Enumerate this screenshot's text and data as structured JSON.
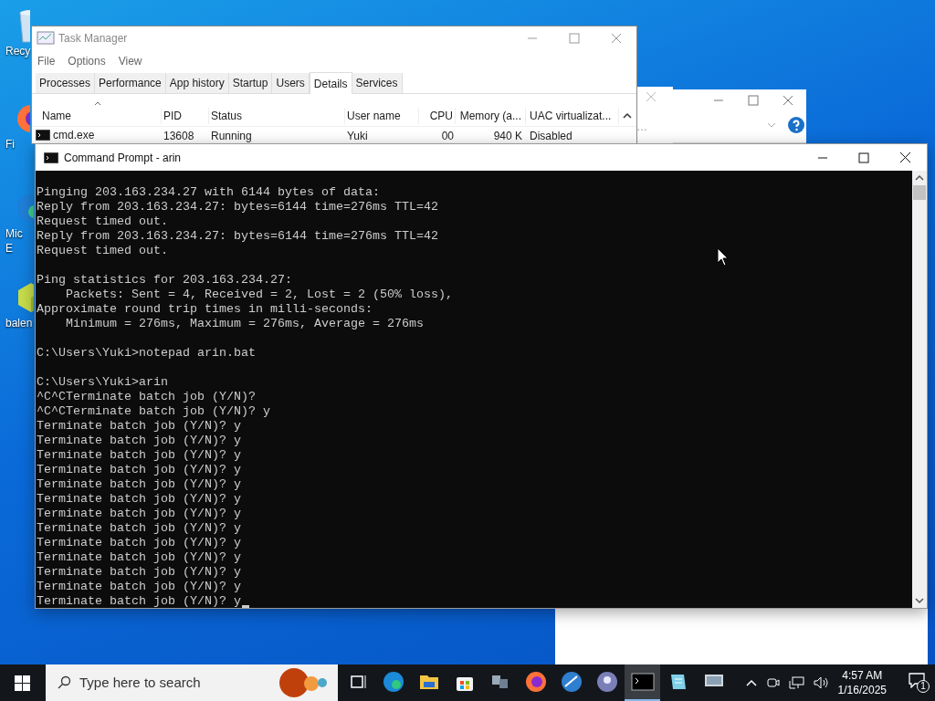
{
  "desktop_icons": [
    {
      "kind": "recycle",
      "label_lines": [
        "Recy"
      ]
    },
    {
      "kind": "firefox",
      "label_lines": [
        "Fi"
      ]
    },
    {
      "kind": "edge",
      "label_lines": [
        "Mic",
        "E"
      ]
    },
    {
      "kind": "balena",
      "label_lines": [
        "balen"
      ]
    }
  ],
  "background_window": {
    "ellipsis": "…"
  },
  "task_manager": {
    "title": "Task Manager",
    "menu": [
      "File",
      "Options",
      "View"
    ],
    "tabs": [
      {
        "label": "Processes",
        "selected": false
      },
      {
        "label": "Performance",
        "selected": false
      },
      {
        "label": "App history",
        "selected": false
      },
      {
        "label": "Startup",
        "selected": false
      },
      {
        "label": "Users",
        "selected": false
      },
      {
        "label": "Details",
        "selected": true
      },
      {
        "label": "Services",
        "selected": false
      }
    ],
    "columns": [
      "Name",
      "PID",
      "Status",
      "User name",
      "CPU",
      "Memory (a...",
      "UAC virtualizat..."
    ],
    "rows": [
      [
        "cmd.exe",
        "13608",
        "Running",
        "Yuki",
        "00",
        "940 K",
        "Disabled"
      ]
    ]
  },
  "command_prompt": {
    "title": "Command Prompt - arin",
    "blocks": [
      [
        "Pinging 203.163.234.27 with 6144 bytes of data:",
        "Reply from 203.163.234.27: bytes=6144 time=276ms TTL=42",
        "Request timed out.",
        "Reply from 203.163.234.27: bytes=6144 time=276ms TTL=42",
        "Request timed out."
      ],
      [
        "Ping statistics for 203.163.234.27:",
        "    Packets: Sent = 4, Received = 2, Lost = 2 (50% loss),",
        "Approximate round trip times in milli-seconds:",
        "    Minimum = 276ms, Maximum = 276ms, Average = 276ms"
      ],
      [
        "C:\\Users\\Yuki>notepad arin.bat"
      ],
      [
        "C:\\Users\\Yuki>arin",
        "^C^CTerminate batch job (Y/N)?",
        "^C^CTerminate batch job (Y/N)? y",
        "Terminate batch job (Y/N)? y",
        "Terminate batch job (Y/N)? y",
        "Terminate batch job (Y/N)? y",
        "Terminate batch job (Y/N)? y",
        "Terminate batch job (Y/N)? y",
        "Terminate batch job (Y/N)? y",
        "Terminate batch job (Y/N)? y",
        "Terminate batch job (Y/N)? y",
        "Terminate batch job (Y/N)? y",
        "Terminate batch job (Y/N)? y",
        "Terminate batch job (Y/N)? y",
        "Terminate batch job (Y/N)? y",
        "Terminate batch job (Y/N)? y"
      ]
    ]
  },
  "taskbar": {
    "search": {
      "placeholder": "Type here to search"
    },
    "apps": [
      {
        "kind": "taskview",
        "active": false
      },
      {
        "kind": "edge",
        "active": false
      },
      {
        "kind": "explorer",
        "active": false
      },
      {
        "kind": "store",
        "active": false
      },
      {
        "kind": "network",
        "active": false
      },
      {
        "kind": "firefox",
        "active": false
      },
      {
        "kind": "globe",
        "active": false
      },
      {
        "kind": "sphere",
        "active": false
      },
      {
        "kind": "terminal",
        "active": true
      },
      {
        "kind": "notepad",
        "active": false
      },
      {
        "kind": "monitor",
        "active": false
      }
    ],
    "time": "4:57 AM",
    "date": "1/16/2025",
    "notifications": "1"
  }
}
